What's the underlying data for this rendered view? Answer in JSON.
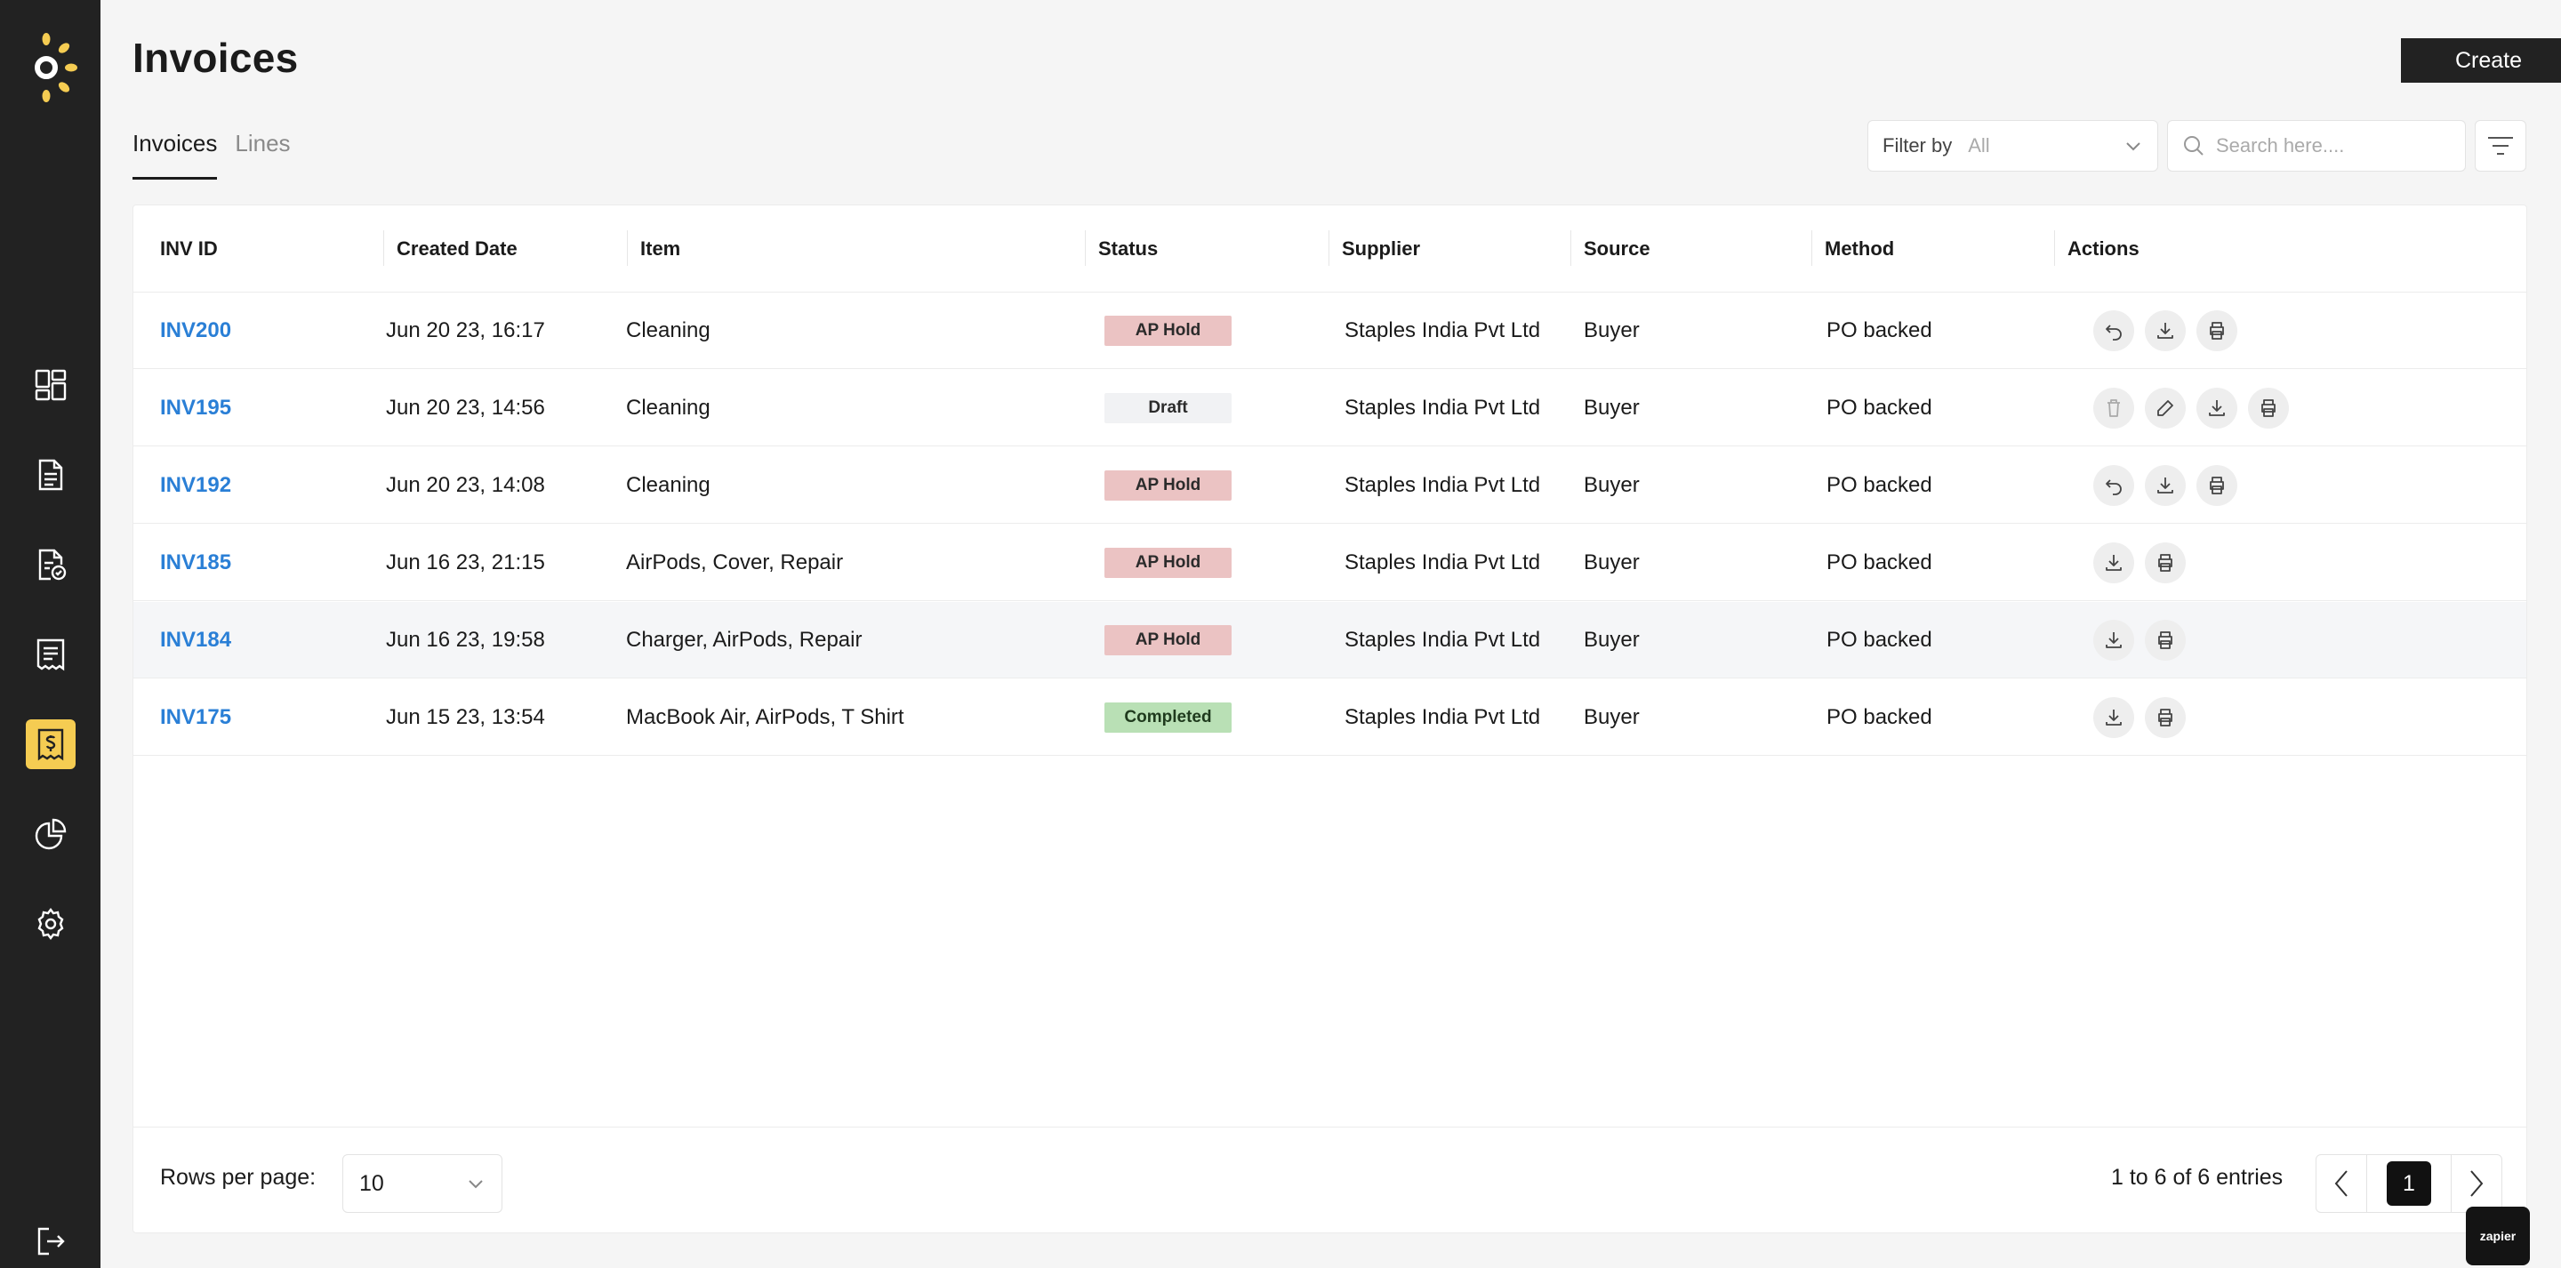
{
  "app": {
    "accent": "#f5cc52",
    "sidebar_bg": "#222222",
    "link_color": "#2a7fd6"
  },
  "sidebar": {
    "items": [
      {
        "icon": "dashboard-icon"
      },
      {
        "icon": "document-icon"
      },
      {
        "icon": "document-check-icon"
      },
      {
        "icon": "receipt-icon"
      },
      {
        "icon": "invoice-dollar-icon",
        "active": true
      },
      {
        "icon": "pie-chart-icon"
      },
      {
        "icon": "gear-icon"
      },
      {
        "icon": "logout-icon"
      }
    ]
  },
  "header": {
    "title": "Invoices",
    "create_label": "Create"
  },
  "tabs": [
    {
      "label": "Invoices",
      "active": true
    },
    {
      "label": "Lines",
      "active": false
    }
  ],
  "toolbar": {
    "filter_label": "Filter by",
    "filter_value": "All",
    "search_placeholder": "Search here...."
  },
  "table": {
    "columns": [
      "INV ID",
      "Created Date",
      "Item",
      "Status",
      "Supplier",
      "Source",
      "Method",
      "Actions"
    ],
    "rows": [
      {
        "id": "INV200",
        "date": "Jun 20 23, 16:17",
        "item": "Cleaning",
        "status": "AP Hold",
        "supplier": "Staples India Pvt Ltd",
        "source": "Buyer",
        "method": "PO backed",
        "actions": [
          "undo-icon",
          "download-icon",
          "print-icon"
        ]
      },
      {
        "id": "INV195",
        "date": "Jun 20 23, 14:56",
        "item": "Cleaning",
        "status": "Draft",
        "supplier": "Staples India Pvt Ltd",
        "source": "Buyer",
        "method": "PO backed",
        "actions": [
          "trash-icon",
          "pencil-icon",
          "download-icon",
          "print-icon"
        ]
      },
      {
        "id": "INV192",
        "date": "Jun 20 23, 14:08",
        "item": "Cleaning",
        "status": "AP Hold",
        "supplier": "Staples India Pvt Ltd",
        "source": "Buyer",
        "method": "PO backed",
        "actions": [
          "undo-icon",
          "download-icon",
          "print-icon"
        ]
      },
      {
        "id": "INV185",
        "date": "Jun 16 23, 21:15",
        "item": "AirPods, Cover, Repair",
        "status": "AP Hold",
        "supplier": "Staples India Pvt Ltd",
        "source": "Buyer",
        "method": "PO backed",
        "actions": [
          "download-icon",
          "print-icon"
        ]
      },
      {
        "id": "INV184",
        "date": "Jun 16 23, 19:58",
        "item": "Charger, AirPods, Repair",
        "status": "AP Hold",
        "supplier": "Staples India Pvt Ltd",
        "source": "Buyer",
        "method": "PO backed",
        "actions": [
          "download-icon",
          "print-icon"
        ]
      },
      {
        "id": "INV175",
        "date": "Jun 15 23, 13:54",
        "item": "MacBook Air, AirPods, T Shirt",
        "status": "Completed",
        "supplier": "Staples India Pvt Ltd",
        "source": "Buyer",
        "method": "PO backed",
        "actions": [
          "download-icon",
          "print-icon"
        ]
      }
    ],
    "status_colors": {
      "AP Hold": {
        "bg": "#ebc3c3",
        "fg": "#2b2b2b"
      },
      "Draft": {
        "bg": "#f1f2f4",
        "fg": "#2b2b2b"
      },
      "Completed": {
        "bg": "#b9e0b5",
        "fg": "#1f3a1d"
      }
    }
  },
  "footer": {
    "rows_per_page_label": "Rows per page:",
    "rows_per_page_value": "10",
    "entries_text": "1 to 6 of 6 entries",
    "current_page": "1"
  },
  "zapier_badge": "zapier"
}
